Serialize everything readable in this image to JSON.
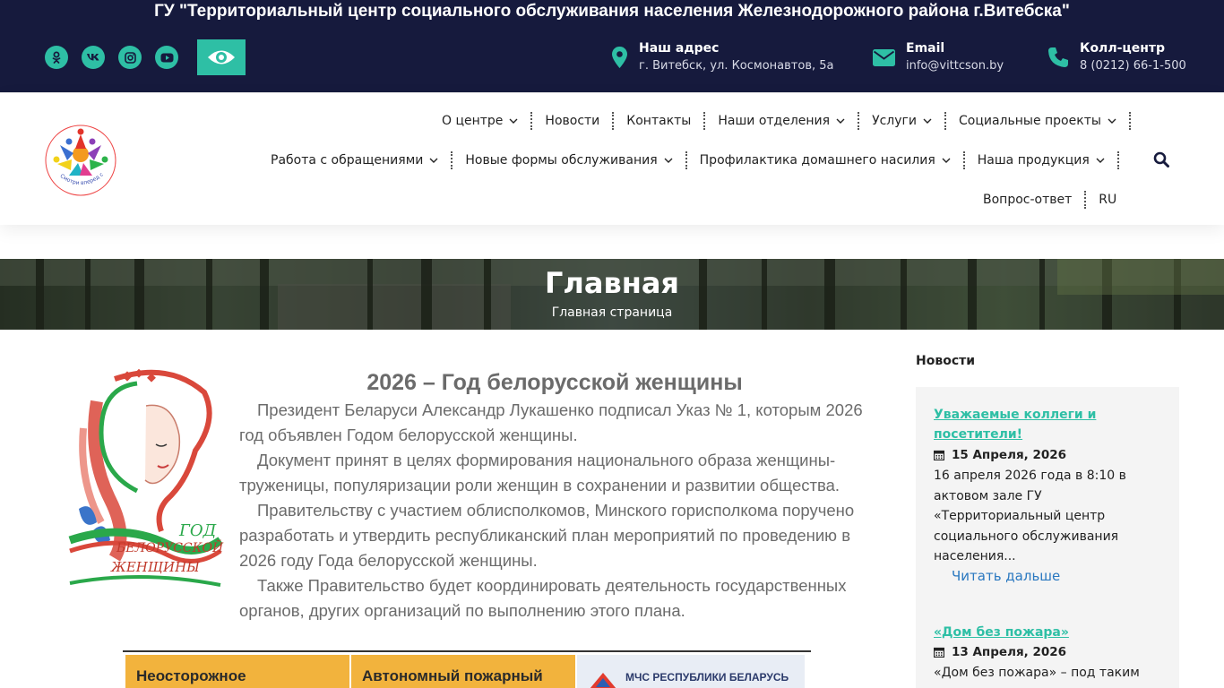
{
  "topbar": {
    "title": "ГУ \"Территориальный центр социального обслуживания населения Железнодорожного района г.Витебска\"",
    "social": [
      "odnoklassniki-icon",
      "vk-icon",
      "instagram-icon",
      "youtube-icon"
    ],
    "accessibility_icon": "eye-icon",
    "contacts": [
      {
        "icon": "map-pin-icon",
        "label": "Наш адрес",
        "value": "г. Витебск, ул. Космонавтов, 5а"
      },
      {
        "icon": "envelope-icon",
        "label": "Email",
        "value": "info@vittcson.by"
      },
      {
        "icon": "phone-icon",
        "label": "Колл-центр",
        "value": "8 (0212) 66-1-500"
      }
    ],
    "accent": "#2ebfa5",
    "background": "#161a3d"
  },
  "nav": {
    "row1": [
      "О центре",
      "Новости",
      "Контакты",
      "Наши отделения",
      "Услуги",
      "Социальные проекты"
    ],
    "row2": [
      "Работа с обращениями",
      "Новые формы обслуживания",
      "Профилактика домашнего насилия",
      "Наша продукция"
    ],
    "row3": [
      "Вопрос-ответ",
      "RU"
    ],
    "logo_text": "Смотри вперед с надеждой"
  },
  "banner": {
    "title": "Главная",
    "subtitle": "Главная страница"
  },
  "article": {
    "title": "2026 – Год белорусской женщины",
    "paragraphs": [
      "Президент Беларуси Александр Лукашенко подписал Указ № 1, которым 2026 год объявлен Годом белорусской женщины.",
      "Документ принят в целях формирования национального образа женщины-труженицы, популяризации роли женщин в сохранении и развитии общества.",
      "Правительству с участием облисполкомов, Минского горисполкома поручено разработать и утвердить республиканский план мероприятий по проведению в 2026 году Года белорусской женщины.",
      "Также Правительство будет координировать деятельность государственных органов, других организаций по выполнению этого плана."
    ],
    "image_text": [
      "ГОД",
      "БЕЛОРУССКОЙ",
      "ЖЕНЩИНЫ"
    ],
    "poster": [
      "Неосторожное",
      "Автономный пожарный",
      "МЧС РЕСПУБЛИКИ БЕЛАРУСЬ"
    ]
  },
  "sidebar": {
    "heading": "Новости",
    "news": [
      {
        "title": "Уважаемые коллеги и посетители!",
        "date": "15 Апреля, 2026",
        "excerpt": "16 апреля 2026 года в 8:10 в актовом зале  ГУ «Территориальный центр социального обслуживания населения...",
        "more": "Читать дальше"
      },
      {
        "title": " «Дом без пожара»",
        "date": "13 Апреля, 2026",
        "excerpt": " «Дом без пожара» – под таким"
      }
    ]
  }
}
